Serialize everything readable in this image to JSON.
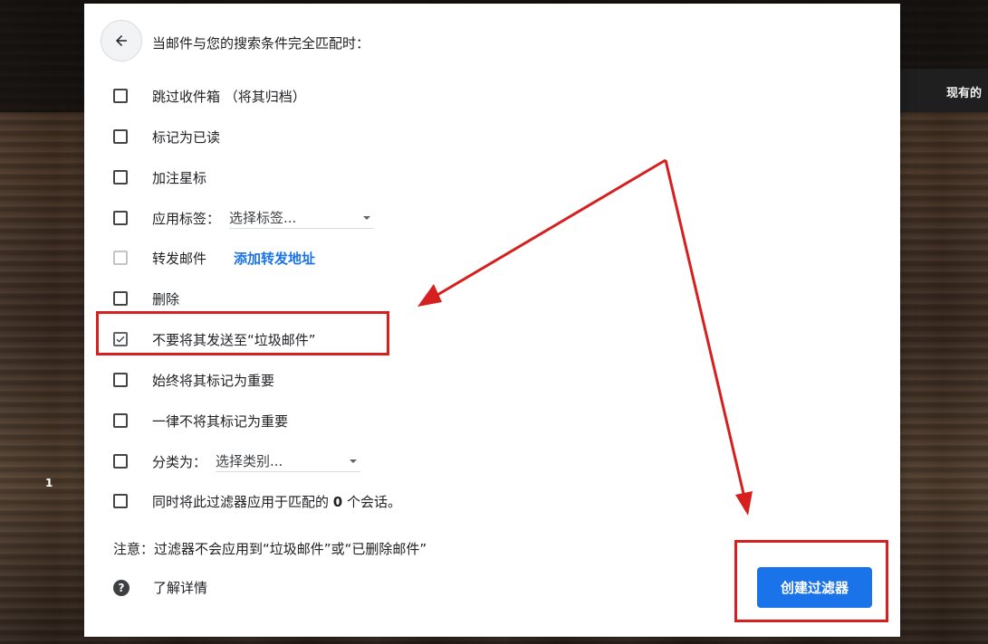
{
  "background": {
    "existing_label": "现有的",
    "page_indicator": "1"
  },
  "dialog": {
    "header": "当邮件与您的搜索条件完全匹配时：",
    "options": [
      {
        "label": "跳过收件箱 （将其归档）",
        "checked": false,
        "disabled": false
      },
      {
        "label": "标记为已读",
        "checked": false,
        "disabled": false
      },
      {
        "label": "加注星标",
        "checked": false,
        "disabled": false
      },
      {
        "label": "应用标签：",
        "checked": false,
        "disabled": false,
        "select_value": "选择标签..."
      },
      {
        "label": "转发邮件",
        "checked": false,
        "disabled": true,
        "link": "添加转发地址"
      },
      {
        "label": "删除",
        "checked": false,
        "disabled": false
      },
      {
        "label": "不要将其发送至“垃圾邮件”",
        "checked": true,
        "disabled": false
      },
      {
        "label": "始终将其标记为重要",
        "checked": false,
        "disabled": false
      },
      {
        "label": "一律不将其标记为重要",
        "checked": false,
        "disabled": false
      },
      {
        "label": "分类为：",
        "checked": false,
        "disabled": false,
        "select_value": "选择类别..."
      },
      {
        "label_prefix": "同时将此过滤器应用于匹配的",
        "count": "0",
        "label_suffix": "个会话。",
        "checked": false,
        "disabled": false
      }
    ],
    "note": "注意：过滤器不会应用到“垃圾邮件”或“已删除邮件”",
    "learn_more": "了解详情",
    "create_button": "创建过滤器"
  },
  "colors": {
    "accent": "#1a73e8",
    "annotation_red": "#d61f1f"
  }
}
